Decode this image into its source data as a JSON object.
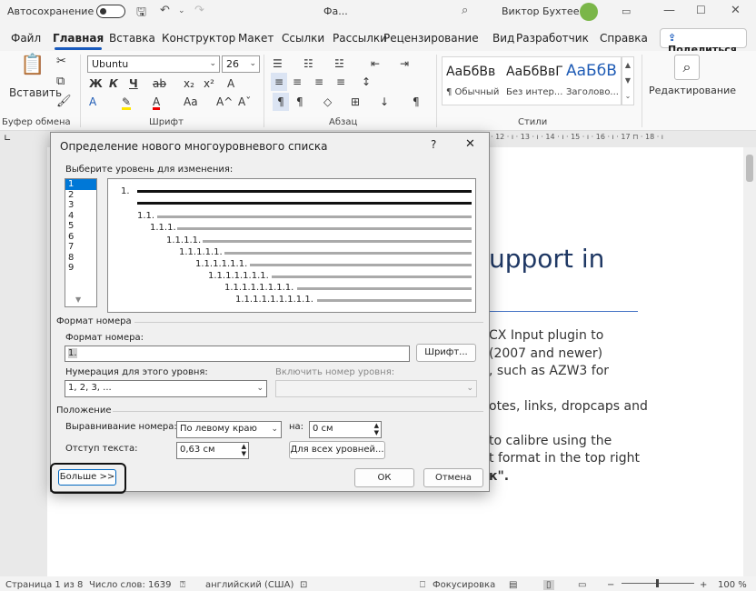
{
  "titlebar": {
    "autosave_label": "Автосохранение",
    "doc_name": "Фа...",
    "user_name": "Виктор Бухтеев"
  },
  "menu": {
    "tabs": [
      "Файл",
      "Главная",
      "Вставка",
      "Конструктор",
      "Макет",
      "Ссылки",
      "Рассылки",
      "Рецензирование",
      "Вид",
      "Разработчик",
      "Справка"
    ],
    "share_label": "Поделиться"
  },
  "ribbon": {
    "paste_label": "Вставить",
    "clipboard_label": "Буфер обмена",
    "font_name": "Ubuntu",
    "font_size": "26",
    "bold": "Ж",
    "italic": "К",
    "underline": "Ч",
    "font_group_label": "Шрифт",
    "paragraph_group_label": "Абзац",
    "styles": [
      {
        "preview": "АаБбВв",
        "name": "¶ Обычный"
      },
      {
        "preview": "АаБбВвГ",
        "name": "Без интер..."
      },
      {
        "preview": "АаБбВ",
        "name": "Заголово..."
      }
    ],
    "styles_group_label": "Стили",
    "editing_label": "Редактирование"
  },
  "document": {
    "heading_fragment": "upport in",
    "lines": [
      "CX Input plugin to",
      "(2007 and newer)",
      ", such as AZW3 for",
      "otes, links, dropcaps and",
      "to calibre using the",
      "t format in the top right",
      "к\"."
    ]
  },
  "status": {
    "page": "Страница 1 из 8",
    "words": "Число слов: 1639",
    "language": "английский (США)",
    "focus": "Фокусировка",
    "zoom": "100 %"
  },
  "dialog": {
    "title": "Определение нового многоуровневого списка",
    "help": "?",
    "close": "✕",
    "choose_level_label": "Выберите уровень для изменения:",
    "levels": [
      "1",
      "2",
      "3",
      "4",
      "5",
      "6",
      "7",
      "8",
      "9"
    ],
    "preview_labels": [
      "1.",
      "1.1.",
      "1.1.1.",
      "1.1.1.1.",
      "1.1.1.1.1.",
      "1.1.1.1.1.1.",
      "1.1.1.1.1.1.1.",
      "1.1.1.1.1.1.1.1.",
      "1.1.1.1.1.1.1.1.1."
    ],
    "number_format_section": "Формат номера",
    "number_format_label": "Формат номера:",
    "number_format_value": "1.",
    "font_button": "Шрифт...",
    "numbering_style_label": "Нумерация для этого уровня:",
    "numbering_style_value": "1, 2, 3, ...",
    "include_level_label": "Включить номер уровня:",
    "include_level_value": "",
    "position_section": "Положение",
    "alignment_label": "Выравнивание номера:",
    "alignment_value": "По левому краю",
    "at_label": "на:",
    "at_value": "0 см",
    "indent_label": "Отступ текста:",
    "indent_value": "0,63 см",
    "all_levels_button": "Для всех уровней...",
    "more_button": "Больше >>",
    "ok_button": "ОК",
    "cancel_button": "Отмена"
  }
}
